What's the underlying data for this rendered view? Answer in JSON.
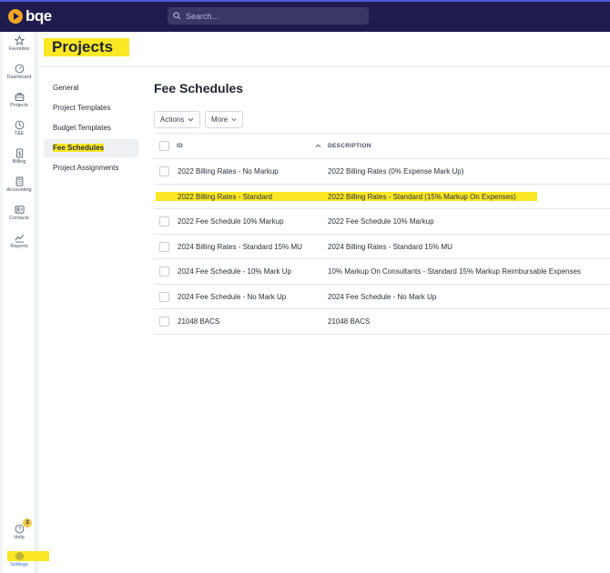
{
  "header": {
    "logo_text": "bqe",
    "search_placeholder": "Search..."
  },
  "rail": {
    "items": [
      {
        "label": "Favorites",
        "icon": "star-icon"
      },
      {
        "label": "Dashboard",
        "icon": "gauge-icon"
      },
      {
        "label": "Projects",
        "icon": "briefcase-icon"
      },
      {
        "label": "T&E",
        "icon": "clock-icon"
      },
      {
        "label": "Billing",
        "icon": "dollar-icon"
      },
      {
        "label": "Accounting",
        "icon": "calculator-icon"
      },
      {
        "label": "Contacts",
        "icon": "contact-card-icon"
      },
      {
        "label": "Reports",
        "icon": "chart-icon"
      }
    ],
    "help_label": "Help",
    "help_badge": "3",
    "settings_label": "Settings"
  },
  "page": {
    "title": "Projects"
  },
  "subnav": {
    "items": [
      "General",
      "Project Templates",
      "Budget Templates",
      "Fee Schedules",
      "Project Assignments"
    ],
    "active": "Fee Schedules"
  },
  "main": {
    "section_title": "Fee Schedules",
    "actions_label": "Actions",
    "more_label": "More"
  },
  "table": {
    "columns": [
      "ID",
      "DESCRIPTION"
    ],
    "rows": [
      {
        "id": "2022 Billing Rates - No Markup",
        "description": "2022 Billing Rates (0% Expense Mark Up)"
      },
      {
        "id": "2022 Billing Rates - Standard",
        "description": "2022 Billing Rates - Standard (15% Markup On Expenses)"
      },
      {
        "id": "2022 Fee Schedule 10% Markup",
        "description": "2022 Fee Schedule 10% Markup"
      },
      {
        "id": "2024 Billing Rates - Standard 15% MU",
        "description": "2024 Billing Rates - Standard 15% MU"
      },
      {
        "id": "2024 Fee Schedule - 10% Mark Up",
        "description": "10% Markup On Consultants - Standard 15% Markup Reimbursable Expenses"
      },
      {
        "id": "2024 Fee Schedule - No Mark Up",
        "description": "2024 Fee Schedule - No Mark Up"
      },
      {
        "id": "21048 BACS",
        "description": "21048 BACS"
      }
    ]
  },
  "colors": {
    "topbar": "#1f1b4d",
    "highlight": "#fbe724",
    "logo_accent": "#f5a623"
  }
}
